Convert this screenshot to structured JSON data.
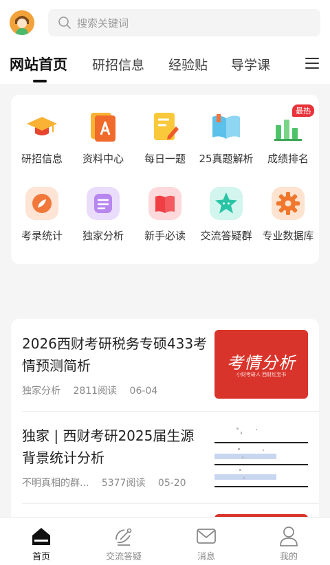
{
  "search": {
    "placeholder": "搜索关键词"
  },
  "tabs": [
    {
      "label": "网站首页",
      "active": true
    },
    {
      "label": "研招信息"
    },
    {
      "label": "经验贴"
    },
    {
      "label": "导学课"
    }
  ],
  "grid": {
    "row1": [
      {
        "label": "研招信息",
        "icon": "graduation-cap-icon"
      },
      {
        "label": "资料中心",
        "icon": "documents-icon"
      },
      {
        "label": "每日一题",
        "icon": "daily-question-icon"
      },
      {
        "label": "25真题解析",
        "icon": "open-book-icon"
      },
      {
        "label": "成绩排名",
        "icon": "bar-chart-icon",
        "badge": "最热"
      }
    ],
    "row2": [
      {
        "label": "考录统计",
        "icon": "compass-icon"
      },
      {
        "label": "独家分析",
        "icon": "note-icon"
      },
      {
        "label": "新手必读",
        "icon": "book-icon"
      },
      {
        "label": "交流答疑群",
        "icon": "star-icon"
      },
      {
        "label": "专业数据库",
        "icon": "gear-icon"
      }
    ]
  },
  "articles": [
    {
      "title": "2026西财考研税务专硕433考情预测简析",
      "source": "独家分析",
      "reads": "2811阅读",
      "date": "06-04",
      "thumb_text": "考情分析",
      "thumb_sub": "小财考研人 西财红宝书"
    },
    {
      "title": "独家 | 西财考研2025届生源背景统计分析",
      "source": "不明真相的群...",
      "reads": "5377阅读",
      "date": "05-20"
    }
  ],
  "bottom_nav": [
    {
      "label": "首页",
      "icon": "home-icon",
      "active": true
    },
    {
      "label": "交流答疑",
      "icon": "satellite-icon"
    },
    {
      "label": "消息",
      "icon": "mail-icon"
    },
    {
      "label": "我的",
      "icon": "user-icon"
    }
  ],
  "colors": {
    "accent_red": "#e8333a",
    "thumb_red": "#d9342b"
  }
}
